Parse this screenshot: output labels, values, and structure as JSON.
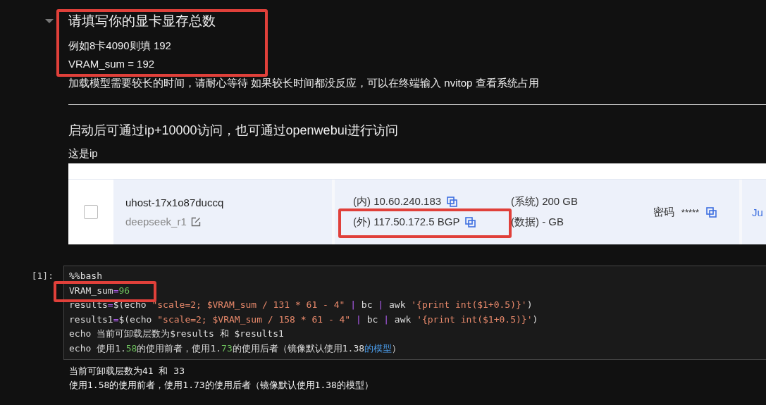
{
  "markdown_cell": {
    "collapsed": false,
    "heading": "请填写你的显卡显存总数",
    "lines": [
      "例如8卡4090则填 192",
      "VRAM_sum = 192",
      "加载模型需要较长的时间，请耐心等待 如果较长时间都没反应，可以在终端输入 nvitop 查看系统占用"
    ],
    "heading2": "启动后可通过ip+10000访问，也可通过openwebui进行访问",
    "caption": "这是ip"
  },
  "host_table": {
    "rows": [
      {
        "checked": false,
        "host": "uhost-17x1o87duccq",
        "name": "deepseek_r1",
        "ip_inner": "(内) 10.60.240.183",
        "ip_outer": "(外) 117.50.172.5 BGP",
        "disk_system": "(系统) 200 GB",
        "disk_data": "(数据) - GB",
        "password_label": "密码",
        "password": "*****",
        "link": "Ju"
      }
    ]
  },
  "code_cell": {
    "prompt": "[1]:",
    "lines": [
      [
        {
          "text": "%%bash",
          "kind": "plain"
        }
      ],
      [
        {
          "text": "VRAM_sum",
          "kind": "plain"
        },
        {
          "text": "=",
          "kind": "op"
        },
        {
          "text": "96",
          "kind": "num"
        }
      ],
      [
        {
          "text": "results",
          "kind": "plain"
        },
        {
          "text": "=",
          "kind": "op"
        },
        {
          "text": "$(echo ",
          "kind": "plain"
        },
        {
          "text": "\"scale=2; $VRAM_sum / 131 * 61 - 4\"",
          "kind": "str"
        },
        {
          "text": " | ",
          "kind": "op"
        },
        {
          "text": "bc",
          "kind": "plain"
        },
        {
          "text": " | ",
          "kind": "op"
        },
        {
          "text": "awk ",
          "kind": "plain"
        },
        {
          "text": "'{print int($1+0.5)}'",
          "kind": "str"
        },
        {
          "text": ")",
          "kind": "plain"
        }
      ],
      [
        {
          "text": "results1",
          "kind": "plain"
        },
        {
          "text": "=",
          "kind": "op"
        },
        {
          "text": "$(echo ",
          "kind": "plain"
        },
        {
          "text": "\"scale=2; $VRAM_sum / 158 * 61 - 4\"",
          "kind": "str"
        },
        {
          "text": " | ",
          "kind": "op"
        },
        {
          "text": "bc",
          "kind": "plain"
        },
        {
          "text": " | ",
          "kind": "op"
        },
        {
          "text": "awk ",
          "kind": "plain"
        },
        {
          "text": "'{print int($1+0.5)}'",
          "kind": "str"
        },
        {
          "text": ")",
          "kind": "plain"
        }
      ],
      [
        {
          "text": "echo 当前可卸载层数为$results 和 $results1",
          "kind": "plain"
        }
      ],
      [
        {
          "text": "echo 使用1.",
          "kind": "plain"
        },
        {
          "text": "58",
          "kind": "num"
        },
        {
          "text": "的使用前者，使用1.",
          "kind": "plain"
        },
        {
          "text": "73",
          "kind": "num"
        },
        {
          "text": "的使用后者（镜像默认使用1.38",
          "kind": "plain"
        },
        {
          "text": "的模型",
          "kind": "link"
        },
        {
          "text": "）",
          "kind": "plain"
        }
      ]
    ],
    "output": [
      "当前可卸载层数为41 和 33",
      "使用1.58的使用前者，使用1.73的使用后者（镜像默认使用1.38的模型）"
    ]
  }
}
